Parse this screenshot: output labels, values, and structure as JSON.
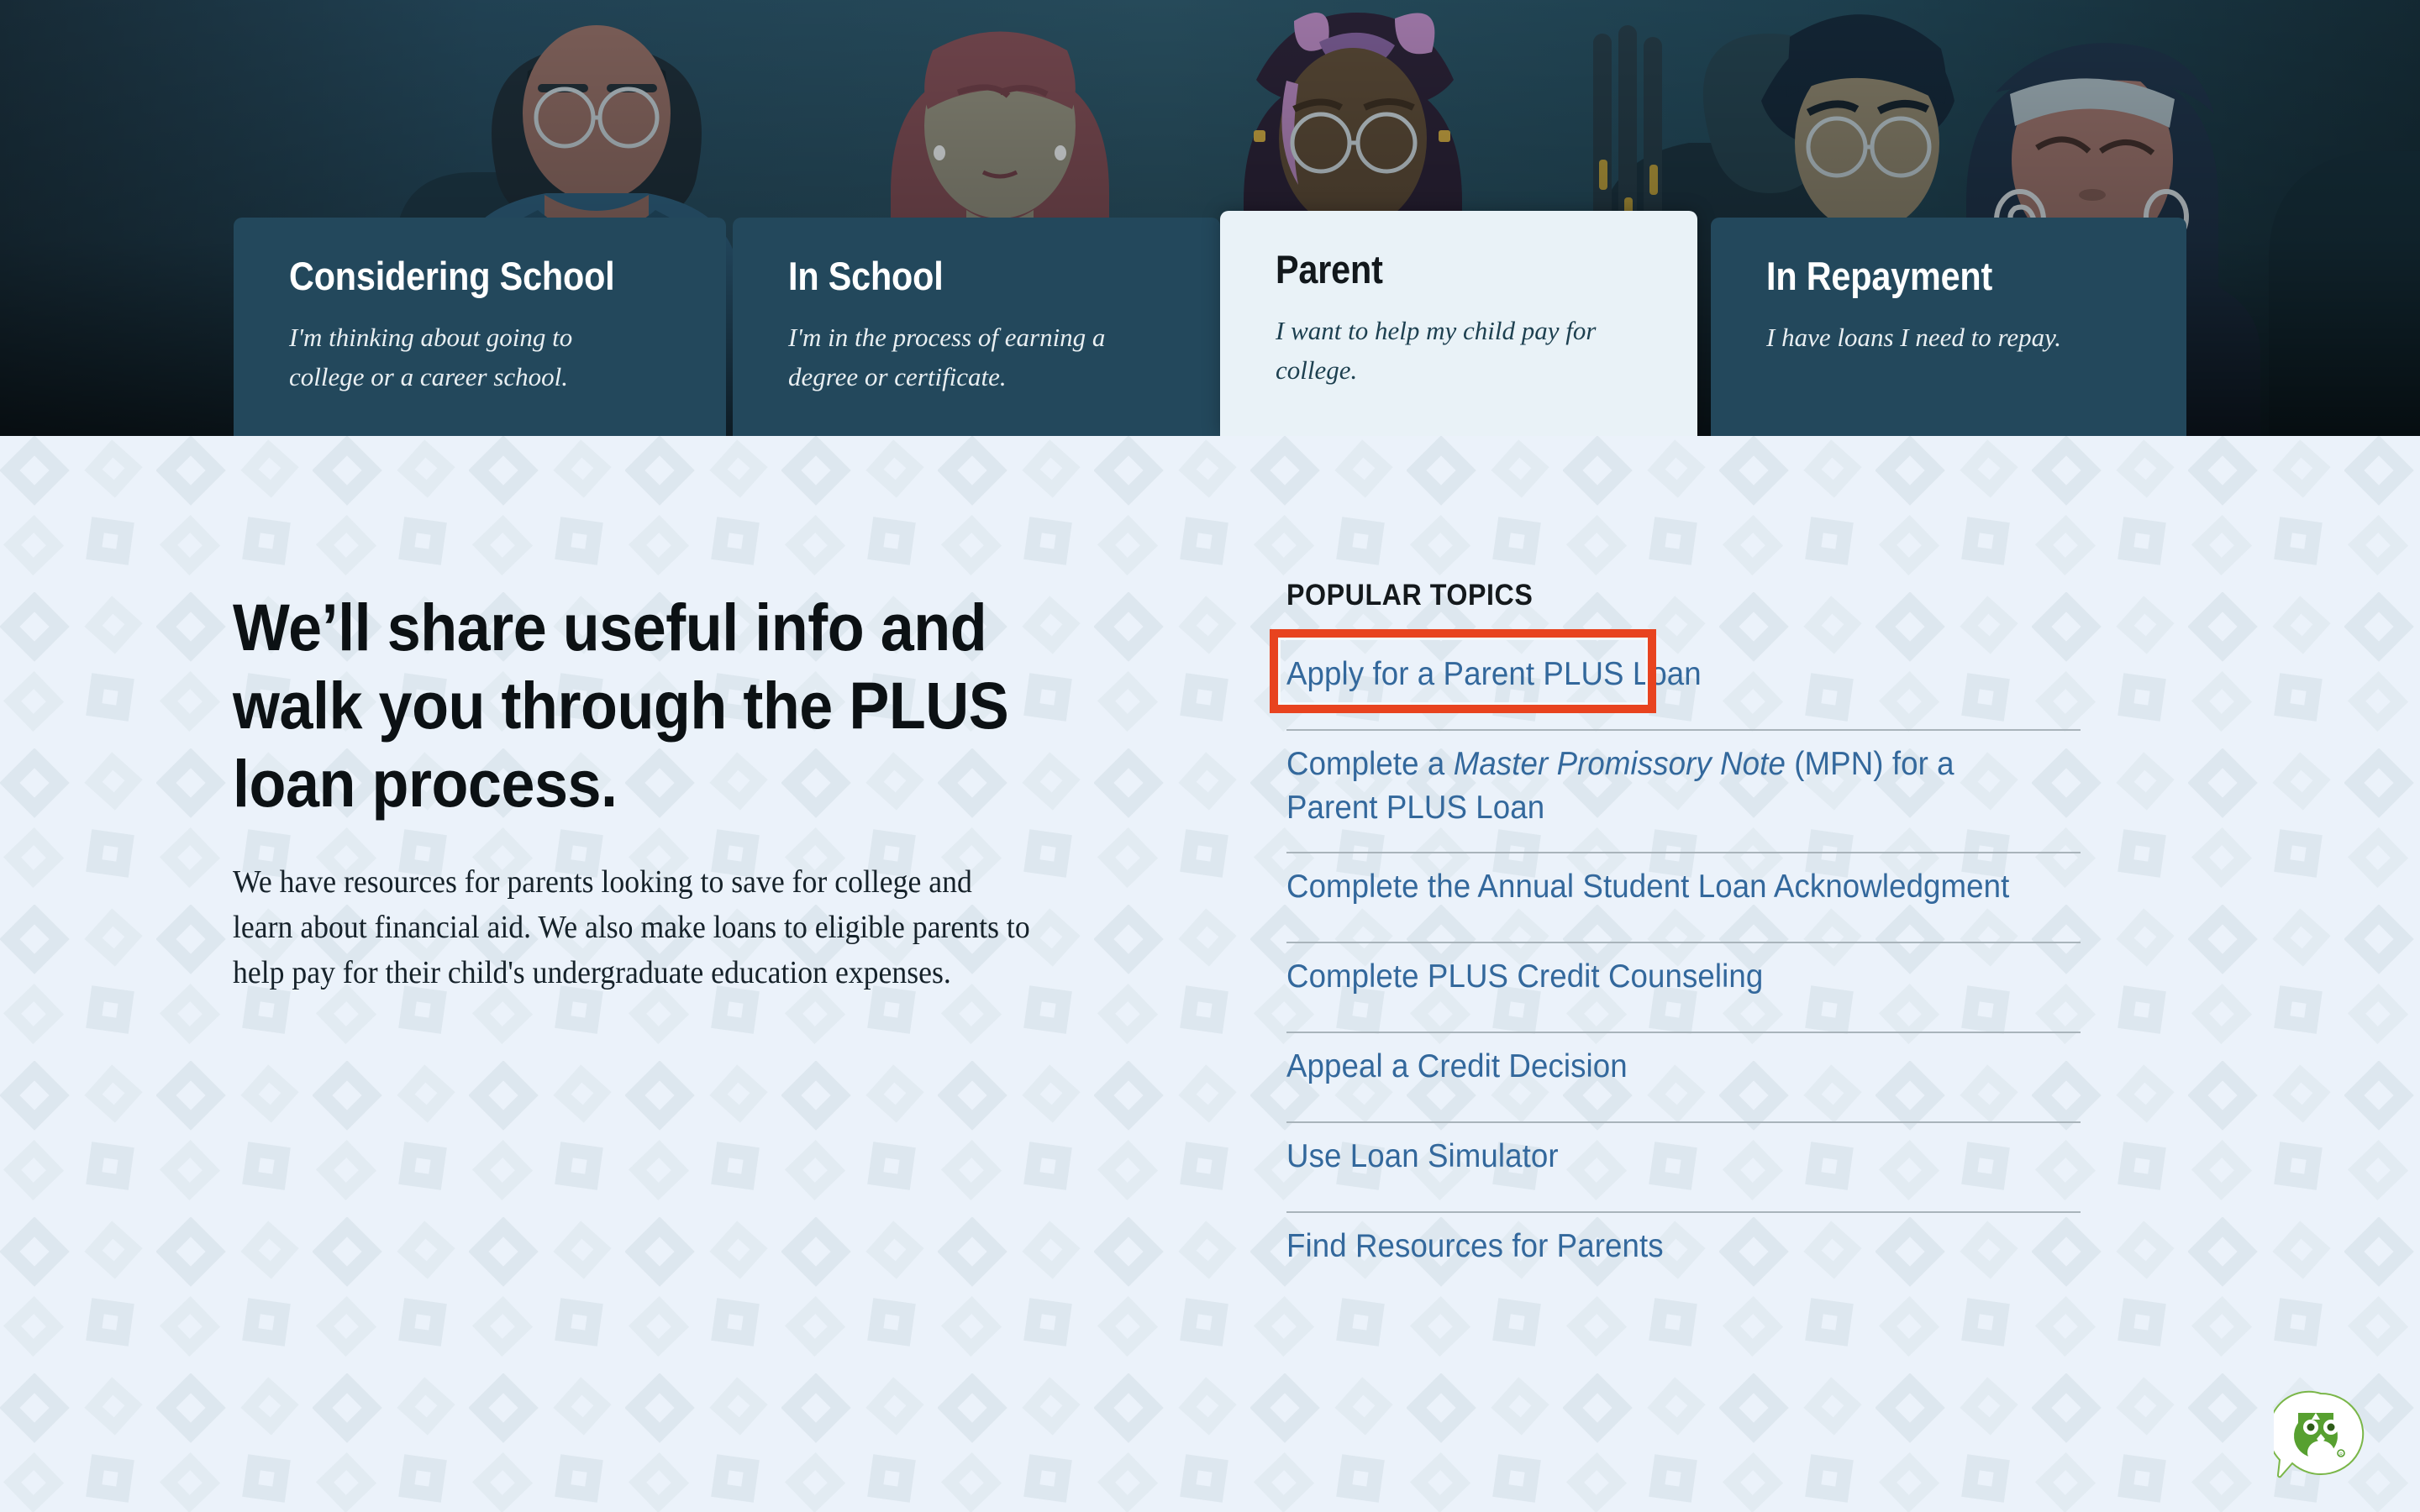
{
  "colors": {
    "hero_dark": "#23485c",
    "hero_bg": "#1d3442",
    "content_bg": "#ebf2fa",
    "active_tab_bg": "#e9f2f7",
    "link_blue": "#33689c",
    "annotation_red": "#e8431f",
    "owl_green": "#57a030",
    "divider_gray": "#a9b4bb",
    "pattern_diamond": "#dfe8ef"
  },
  "hero": {
    "alt": "illustration of diverse students in graduation regalia",
    "tabs": [
      {
        "id": "considering",
        "title": "Considering School",
        "subtitle": "I'm thinking about going to college or a career school.",
        "active": false
      },
      {
        "id": "in-school",
        "title": "In School",
        "subtitle": "I'm in the process of earning a degree or certificate.",
        "active": false
      },
      {
        "id": "parent",
        "title": "Parent",
        "subtitle": "I want to help my child pay for college.",
        "active": true
      },
      {
        "id": "in-repayment",
        "title": "In Repayment",
        "subtitle": "I have loans I need to repay.",
        "active": false
      }
    ]
  },
  "main": {
    "heading": "We’ll share useful info and walk you through the PLUS loan process.",
    "body": "We have resources for parents looking to save for college and learn about financial aid. We also make loans to eligible parents to help pay for their child's undergraduate education expenses."
  },
  "popular_topics": {
    "label": "POPULAR TOPICS",
    "items": [
      {
        "id": "apply-parent-plus-loan",
        "text": "Apply for a Parent PLUS Loan",
        "highlighted": true
      },
      {
        "id": "complete-mpn",
        "text_before": "Complete a ",
        "text_italic": "Master Promissory Note",
        "text_after": " (MPN) for a Parent PLUS Loan",
        "text": "Complete a Master Promissory Note (MPN) for a Parent PLUS Loan",
        "highlighted": false
      },
      {
        "id": "annual-student-loan-acknowledgment",
        "text": "Complete the Annual Student Loan Acknowledgment",
        "highlighted": false
      },
      {
        "id": "plus-credit-counseling",
        "text": "Complete PLUS Credit Counseling",
        "highlighted": false
      },
      {
        "id": "appeal-credit-decision",
        "text": "Appeal a Credit Decision",
        "highlighted": false
      },
      {
        "id": "use-loan-simulator",
        "text": "Use Loan Simulator",
        "highlighted": false
      },
      {
        "id": "find-resources-for-parents",
        "text": "Find Resources for Parents",
        "highlighted": false
      }
    ]
  },
  "chat": {
    "icon": "owl-chat-icon",
    "label": "Virtual assistant"
  }
}
